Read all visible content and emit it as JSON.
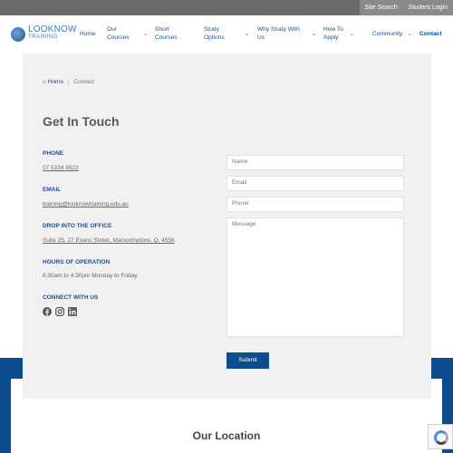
{
  "topbar": {
    "site_search": "Site Search",
    "student_login": "Student Login"
  },
  "logo": {
    "name": "LOOKNOW",
    "sub": "TRAINING"
  },
  "nav": {
    "home": "Home",
    "our_courses_1": "Our",
    "our_courses_2": "Courses",
    "short_courses_1": "Short",
    "short_courses_2": "Courses",
    "study_options_1": "Study",
    "study_options_2": "Options",
    "why_study_1": "Why Study With",
    "why_study_2": "Us",
    "how_to_apply_1": "How To",
    "how_to_apply_2": "Apply",
    "community": "Community",
    "contact": "Contact"
  },
  "breadcrumb": {
    "home": "Home",
    "current": "Contact"
  },
  "page_title": "Get In Touch",
  "contact": {
    "phone_label": "PHONE",
    "phone_value": "07 5334 9922",
    "email_label": "EMAIL",
    "email_value": "training@looknowtraining.edu.au",
    "office_label": "DROP INTO THE OFFICE",
    "office_value": "Suite 25, 27 Evans Street, Maroochydore, Q, 4558",
    "hours_label": "HOURS OF OPERATION",
    "hours_value": "8:30am to 4:30pm Monday to Friday.",
    "connect_label": "CONNECT WITH US"
  },
  "form": {
    "name_placeholder": "Name",
    "email_placeholder": "Email",
    "phone_placeholder": "Phone",
    "message_placeholder": "Message",
    "submit_label": "Submit"
  },
  "location_title": "Our Location",
  "colors": {
    "brand_blue": "#0d4c8e",
    "link_blue": "#1f4e8c",
    "card_bg": "#f1f1f1"
  }
}
